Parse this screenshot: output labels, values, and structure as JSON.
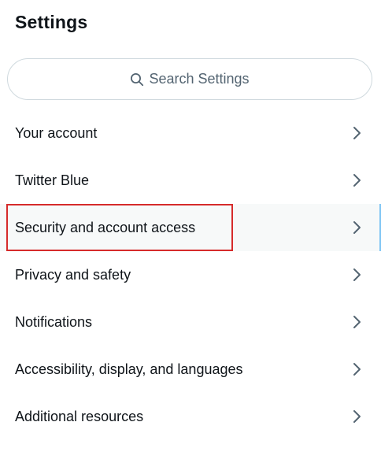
{
  "header": {
    "title": "Settings"
  },
  "search": {
    "placeholder": "Search Settings",
    "icon": "search-icon"
  },
  "menu": {
    "items": [
      {
        "label": "Your account",
        "icon": "chevron-right-icon"
      },
      {
        "label": "Twitter Blue",
        "icon": "chevron-right-icon"
      },
      {
        "label": "Security and account access",
        "icon": "chevron-right-icon",
        "active": true,
        "highlighted": true
      },
      {
        "label": "Privacy and safety",
        "icon": "chevron-right-icon"
      },
      {
        "label": "Notifications",
        "icon": "chevron-right-icon"
      },
      {
        "label": "Accessibility, display, and languages",
        "icon": "chevron-right-icon"
      },
      {
        "label": "Additional resources",
        "icon": "chevron-right-icon"
      }
    ]
  },
  "colors": {
    "text": "#0f1419",
    "secondary_text": "#536471",
    "border": "#cfd9de",
    "active_bg": "#f7f9f9",
    "highlight": "#d62b2b"
  }
}
